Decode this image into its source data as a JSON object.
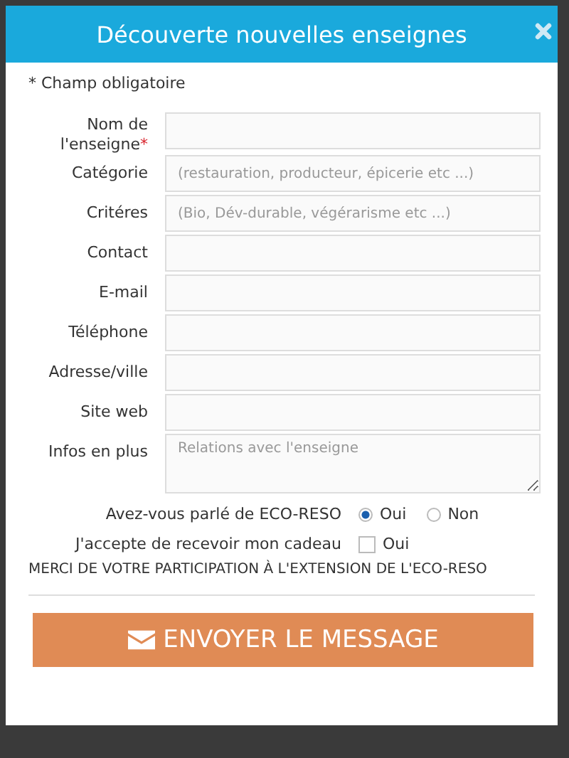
{
  "modal": {
    "title": "Découverte nouvelles enseignes",
    "required_note": "* Champ obligatoire"
  },
  "fields": [
    {
      "kind": "text",
      "label": "Nom de l'enseigne",
      "required_mark": "*"
    },
    {
      "kind": "text",
      "label": "Catégorie",
      "placeholder": "(restauration, producteur, épicerie etc ...)"
    },
    {
      "kind": "text",
      "label": "Critéres",
      "placeholder": "(Bio, Dév-durable, végérarisme etc ...)"
    },
    {
      "kind": "text",
      "label": "Contact"
    },
    {
      "kind": "text",
      "label": "E-mail"
    },
    {
      "kind": "text",
      "label": "Téléphone"
    },
    {
      "kind": "text",
      "label": "Adresse/ville"
    },
    {
      "kind": "text",
      "label": "Site web"
    },
    {
      "kind": "textarea",
      "label": "Infos en plus",
      "placeholder": "Relations avec l'enseigne"
    }
  ],
  "radio_group": {
    "label": "Avez-vous parlé de ECO-RESO",
    "options": [
      {
        "label": "Oui",
        "selected": true
      },
      {
        "label": "Non",
        "selected": false
      }
    ]
  },
  "checkbox": {
    "label": "J'accepte de recevoir mon cadeau",
    "option": "Oui",
    "checked": false
  },
  "thanks": "MERCI DE VOTRE PARTICIPATION À L'EXTENSION DE L'ECO-RESO",
  "submit_button": "ENVOYER LE MESSAGE"
}
